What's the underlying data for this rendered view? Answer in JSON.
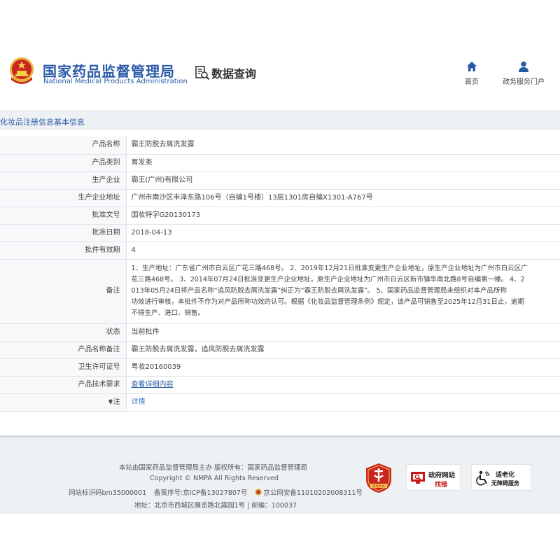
{
  "header": {
    "brand_cn": "国家药品监督管理局",
    "brand_en": "National Medical Products Administration",
    "data_query": "数据查询",
    "nav": {
      "home": "首页",
      "portal": "政务服务门户"
    }
  },
  "title_bar": "化妆品注册信息基本信息",
  "details": {
    "product_name": {
      "label": "产品名称",
      "value": "霸王防脱去屑洗发露"
    },
    "product_category": {
      "label": "产品类别",
      "value": "育发类"
    },
    "manufacturer": {
      "label": "生产企业",
      "value": "霸王(广州)有限公司"
    },
    "manufacturer_address": {
      "label": "生产企业地址",
      "value": "广州市南沙区丰泽东路106号（自编1号楼）13层1301房自编X1301-A767号"
    },
    "approval_number": {
      "label": "批准文号",
      "value": "国妆特字G20130173"
    },
    "approval_date": {
      "label": "批准日期",
      "value": "2018-04-13"
    },
    "validity": {
      "label": "批件有效期",
      "value": "4"
    },
    "remarks": {
      "label": "备注",
      "lines": [
        "1、生产地址：广东省广州市白云区广花三路468号。 2、2019年12月21日批准变更生产企业地址，原生产企业地址为广州市白云区广",
        "花三路468号。 3、2014年07月24日批准变更生产企业地址，原生产企业地址为广州市白云区新市镇华南北路8号自编第一幢。 4、2",
        "013年05月24日将产品名称“追风防脱去屑洗发露”纠正为“霸王防脱去屑洗发露”。 5、国家药品监督管理局未组织对本产品所称",
        "功效进行审核，本批件不作为对产品所称功效的认可。根据《化妆品监督管理条例》规定，该产品可销售至2025年12月31日止，逾期",
        "不得生产、进口、销售。"
      ]
    },
    "status": {
      "label": "状态",
      "value": "当前批件"
    },
    "name_remarks": {
      "label": "产品名称备注",
      "value": "霸王防脱去屑洗发露，追风防脱去屑洗发露"
    },
    "health_license": {
      "label": "卫生许可证号",
      "value": "粤妆20160039"
    },
    "tech_requirements": {
      "label": "产品技术要求",
      "value": "查看详细内容"
    },
    "note": {
      "label": "注",
      "value": "详情"
    }
  },
  "footer": {
    "line1": "本站由国家药品监督管理局主办 版权所有：国家药品监督管理局",
    "line2": "Copyright © NMPA All Rights Reserved",
    "site_id": "网站标识码bm35000001",
    "icp": "备案序号:京ICP备13027807号",
    "police": "京公网安备11010202008311号",
    "address": "地址：北京市西城区展览路北露园1号 | 邮编：100037",
    "dangzheng": "党政机关",
    "zhaocuo_title": "政府网站",
    "zhaocuo_sub": "找错",
    "aged_title": "适老化",
    "aged_sub": "无障碍服务"
  },
  "colors": {
    "brand_blue": "#2a5ba6",
    "link_blue": "#3a74c8",
    "badge_red": "#c51a1a"
  }
}
